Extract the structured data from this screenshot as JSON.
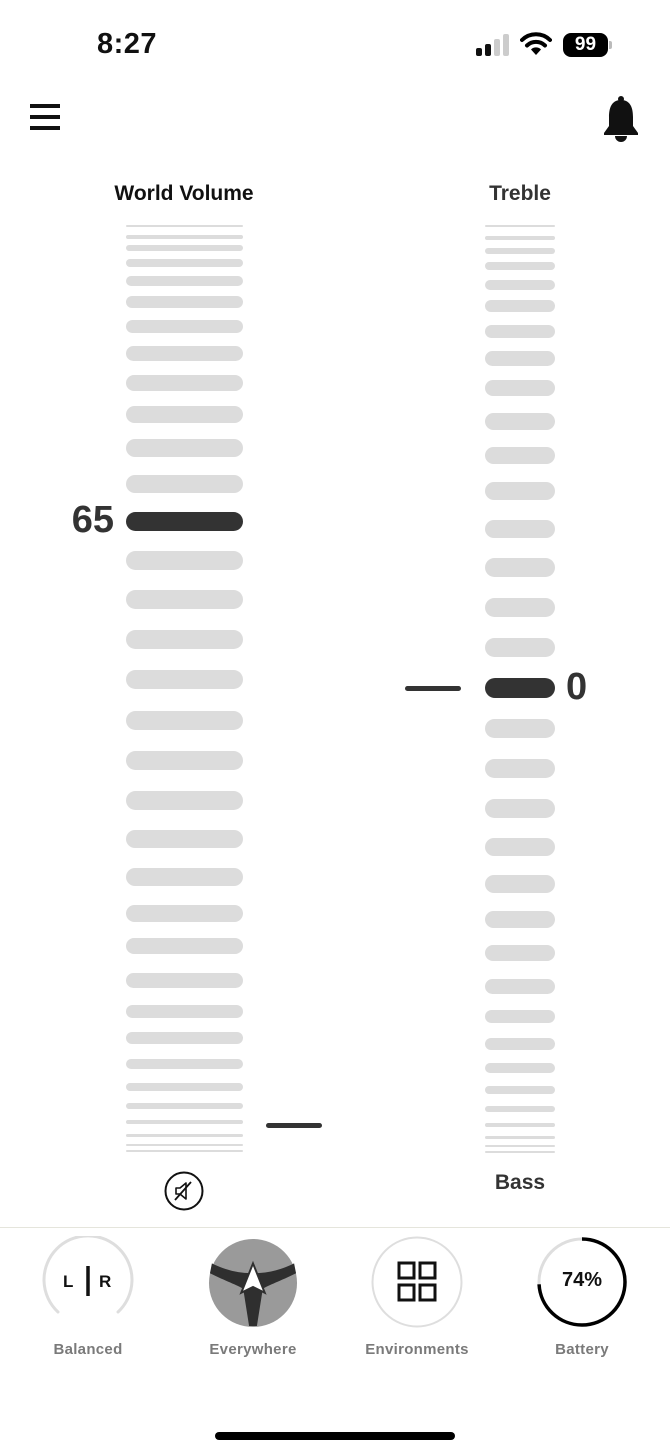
{
  "status_bar": {
    "time": "8:27",
    "signal_bars_active": 2,
    "signal_bars_total": 4,
    "wifi_icon": "wifi-icon",
    "battery_level": "99"
  },
  "header": {
    "menu_icon": "hamburger-menu-icon",
    "notification_icon": "bell-icon"
  },
  "world_volume": {
    "title": "World Volume",
    "value": "65",
    "mute_icon": "mute-speaker-icon"
  },
  "tone": {
    "top_label": "Treble",
    "bottom_label": "Bass",
    "value": "0"
  },
  "bottom_nav": {
    "items": [
      {
        "label": "Balanced",
        "icon": "left-right-balance-icon",
        "left_letter": "L",
        "right_letter": "R"
      },
      {
        "label": "Everywhere",
        "icon": "spatial-audio-everywhere-icon"
      },
      {
        "label": "Environments",
        "icon": "grid-four-squares-icon"
      },
      {
        "label": "Battery",
        "icon": "battery-ring-icon",
        "value": "74%",
        "fraction": 0.74
      }
    ]
  },
  "colors": {
    "selected_bar": "#333333",
    "unselected_bar": "#dcdcdc",
    "label_gray": "#7a7a7a",
    "everywhere_bg": "#9a9a9a"
  }
}
